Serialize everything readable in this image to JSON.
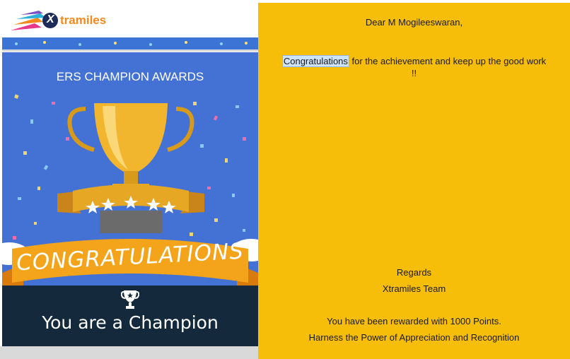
{
  "logo": {
    "brand": "tramiles",
    "mark": "X"
  },
  "poster": {
    "title": "ERS CHAMPION AWARDS",
    "banner_text": "CONGRATULATIONS",
    "tagline": "You are a Champion"
  },
  "message": {
    "greeting": "Dear M Mogileeswaran,",
    "highlight_word": "Congratulations",
    "body_rest": " for the achievement and keep up the good work",
    "body_end": "!!",
    "closing": "Regards",
    "signature": "Xtramiles Team",
    "points_line": "You have been rewarded with 1000 Points.",
    "tagline_line": "Harness the Power of Appreciation and Recognition"
  },
  "colors": {
    "accent_orange": "#f28a1e",
    "poster_blue": "#4472d4",
    "message_yellow": "#f6bd09",
    "dark_navy": "#142a3c"
  },
  "icons": [
    "xtramiles-logo-icon",
    "trophy-illustration",
    "small-trophy-icon",
    "star-icon"
  ]
}
